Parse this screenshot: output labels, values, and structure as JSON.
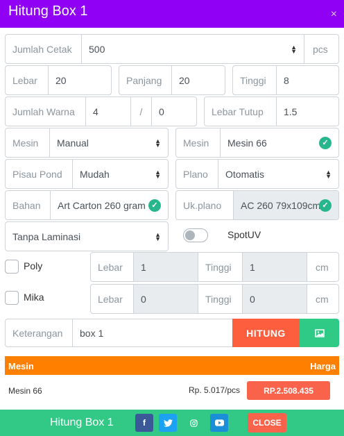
{
  "header": {
    "title": "Hitung Box 1",
    "close_glyph": "×"
  },
  "jumlah_cetak": {
    "label": "Jumlah Cetak",
    "value": "500",
    "unit": "pcs"
  },
  "dimensions": {
    "lebar": {
      "label": "Lebar",
      "value": "20"
    },
    "panjang": {
      "label": "Panjang",
      "value": "20"
    },
    "tinggi": {
      "label": "Tinggi",
      "value": "8"
    }
  },
  "warna": {
    "label": "Jumlah Warna",
    "value": "4",
    "separator": "/",
    "value2": "0"
  },
  "lebar_tutup": {
    "label": "Lebar Tutup",
    "value": "1.5"
  },
  "mesin_select": {
    "label": "Mesin",
    "value": "Manual"
  },
  "mesin_selected": {
    "label": "Mesin",
    "value": "Mesin 66"
  },
  "pisau_pond": {
    "label": "Pisau Pond",
    "value": "Mudah"
  },
  "plano": {
    "label": "Plano",
    "value": "Otomatis"
  },
  "bahan": {
    "label": "Bahan",
    "value": "Art Carton 260 gram"
  },
  "ukplano": {
    "label": "Uk.plano",
    "value": "AC 260 79x109cm"
  },
  "laminasi": {
    "value": "Tanpa Laminasi"
  },
  "spotuv": {
    "label": "SpotUV",
    "on": false
  },
  "poly": {
    "label": "Poly",
    "checked": false,
    "lebar_label": "Lebar",
    "lebar": "1",
    "tinggi_label": "Tinggi",
    "tinggi": "1",
    "unit": "cm"
  },
  "mika": {
    "label": "Mika",
    "checked": false,
    "lebar_label": "Lebar",
    "lebar": "0",
    "tinggi_label": "Tinggi",
    "tinggi": "0",
    "unit": "cm"
  },
  "keterangan": {
    "label": "Keterangan",
    "value": "box 1"
  },
  "actions": {
    "hitung": "HITUNG",
    "image_icon": "image-icon"
  },
  "result": {
    "col_mesin": "Mesin",
    "col_harga": "Harga",
    "mesin": "Mesin 66",
    "unit_price": "Rp. 5.017/pcs",
    "total": "RP.2.508.435"
  },
  "footer": {
    "title": "Hitung Box 1",
    "social": [
      "facebook-icon",
      "twitter-icon",
      "instagram-icon",
      "youtube-icon"
    ],
    "close": "CLOSE"
  },
  "colors": {
    "header": "#8f00f5",
    "orange": "#ff7f00",
    "red": "#f9634b",
    "green": "#32c987",
    "check": "#28b78d"
  }
}
